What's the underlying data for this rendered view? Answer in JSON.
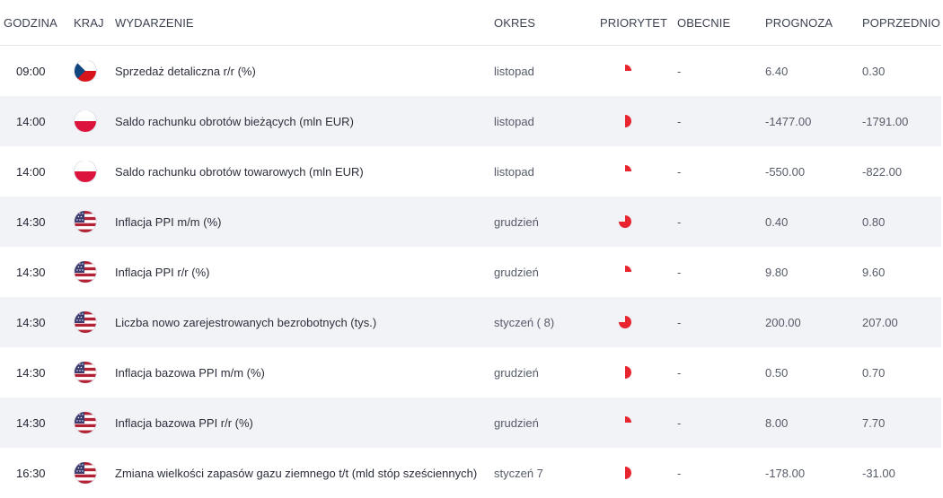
{
  "header": {
    "time": "GODZINA",
    "country": "KRAJ",
    "event": "WYDARZENIE",
    "period": "OKRES",
    "priority": "PRIORYTET",
    "actual": "OBECNIE",
    "forecast": "PROGNOZA",
    "previous": "POPRZEDNIO"
  },
  "colors": {
    "priority": "#e8262f",
    "alt_row": "#f2f3f7"
  },
  "rows": [
    {
      "time": "09:00",
      "flag": "cz",
      "event": "Sprzedaż detaliczna r/r (%)",
      "period": "listopad",
      "priority": 1,
      "actual": "-",
      "forecast": "6.40",
      "previous": "0.30"
    },
    {
      "time": "14:00",
      "flag": "pl",
      "event": "Saldo rachunku obrotów bieżących (mln EUR)",
      "period": "listopad",
      "priority": 2,
      "actual": "-",
      "forecast": "-1477.00",
      "previous": "-1791.00"
    },
    {
      "time": "14:00",
      "flag": "pl",
      "event": "Saldo rachunku obrotów towarowych (mln EUR)",
      "period": "listopad",
      "priority": 1,
      "actual": "-",
      "forecast": "-550.00",
      "previous": "-822.00"
    },
    {
      "time": "14:30",
      "flag": "us",
      "event": "Inflacja PPI m/m (%)",
      "period": "grudzień",
      "priority": 3,
      "actual": "-",
      "forecast": "0.40",
      "previous": "0.80"
    },
    {
      "time": "14:30",
      "flag": "us",
      "event": "Inflacja PPI r/r (%)",
      "period": "grudzień",
      "priority": 1,
      "actual": "-",
      "forecast": "9.80",
      "previous": "9.60"
    },
    {
      "time": "14:30",
      "flag": "us",
      "event": "Liczba nowo zarejestrowanych bezrobotnych (tys.)",
      "period": "styczeń ( 8)",
      "priority": 3,
      "actual": "-",
      "forecast": "200.00",
      "previous": "207.00"
    },
    {
      "time": "14:30",
      "flag": "us",
      "event": "Inflacja bazowa PPI m/m (%)",
      "period": "grudzień",
      "priority": 2,
      "actual": "-",
      "forecast": "0.50",
      "previous": "0.70"
    },
    {
      "time": "14:30",
      "flag": "us",
      "event": "Inflacja bazowa PPI r/r (%)",
      "period": "grudzień",
      "priority": 1,
      "actual": "-",
      "forecast": "8.00",
      "previous": "7.70"
    },
    {
      "time": "16:30",
      "flag": "us",
      "event": "Zmiana wielkości zapasów gazu ziemnego t/t (mld stóp sześciennych)",
      "period": "styczeń 7",
      "priority": 2,
      "actual": "-",
      "forecast": "-178.00",
      "previous": "-31.00"
    }
  ]
}
